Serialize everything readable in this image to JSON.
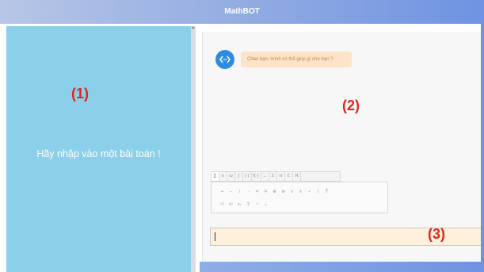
{
  "app": {
    "title": "MathBOT"
  },
  "left_panel": {
    "region_label": "(1)",
    "prompt": "Hãy nhập vào một bài toán !"
  },
  "chat": {
    "region_label": "(2)",
    "messages": [
      {
        "sender": "bot",
        "avatar_icon": "bot-code-icon",
        "text": "Chào bạn, mình có thể giúp gì cho bạn ?"
      }
    ]
  },
  "math_editor": {
    "tabs": [
      "Σ",
      "x",
      "ω",
      "∫",
      "(·)",
      "f(·)",
      "↔",
      "Σ",
      "π",
      "ℂ",
      "ℝ"
    ],
    "symbols_row1": [
      "+",
      "−",
      "/",
      "·",
      "≠",
      "∓",
      "⊕",
      "⊗",
      "∨",
      "∧",
      "∘",
      "√",
      "∛"
    ],
    "symbols_row2": [
      "ⁿ√",
      "xⁿ",
      "xₙ",
      "∓",
      "ⁿ",
      "ₓ"
    ]
  },
  "input": {
    "region_label": "(3)",
    "value": "",
    "placeholder": ""
  },
  "colors": {
    "title_bar": "#8fa9e2",
    "left_panel": "#8ccfe8",
    "bot_avatar": "#2f8be0",
    "bubble": "#fde4c8",
    "input_bg": "#fdf0dd",
    "label_red": "#e0241b"
  }
}
